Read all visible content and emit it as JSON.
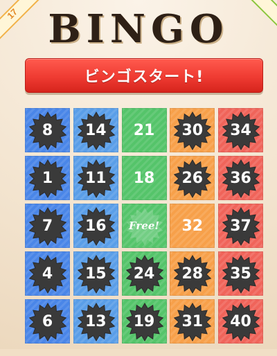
{
  "header": {
    "tagline": "",
    "title": "BINGO",
    "corner_left_text": "17"
  },
  "start_button": {
    "label": "ビンゴスタート!"
  },
  "board": {
    "colors": {
      "blue": "#4a86e8",
      "lblue": "#5a9ee8",
      "green": "#55c46a",
      "orange": "#f7a04a",
      "red": "#f0645a",
      "burst": "#3a3a3a"
    },
    "free_label": "Free!",
    "rows": [
      [
        {
          "value": "8",
          "color": "blue",
          "marked": true
        },
        {
          "value": "14",
          "color": "lblue",
          "marked": true
        },
        {
          "value": "21",
          "color": "green",
          "marked": false
        },
        {
          "value": "30",
          "color": "orange",
          "marked": true
        },
        {
          "value": "34",
          "color": "red",
          "marked": true
        }
      ],
      [
        {
          "value": "1",
          "color": "blue",
          "marked": true
        },
        {
          "value": "11",
          "color": "lblue",
          "marked": true
        },
        {
          "value": "18",
          "color": "green",
          "marked": false
        },
        {
          "value": "26",
          "color": "orange",
          "marked": true
        },
        {
          "value": "36",
          "color": "red",
          "marked": true
        }
      ],
      [
        {
          "value": "7",
          "color": "blue",
          "marked": true
        },
        {
          "value": "16",
          "color": "lblue",
          "marked": true
        },
        {
          "value": "Free!",
          "color": "green",
          "marked": false,
          "free": true
        },
        {
          "value": "32",
          "color": "orange",
          "marked": false
        },
        {
          "value": "37",
          "color": "red",
          "marked": true
        }
      ],
      [
        {
          "value": "4",
          "color": "blue",
          "marked": true
        },
        {
          "value": "15",
          "color": "lblue",
          "marked": true
        },
        {
          "value": "24",
          "color": "green",
          "marked": true
        },
        {
          "value": "28",
          "color": "orange",
          "marked": true
        },
        {
          "value": "35",
          "color": "red",
          "marked": true
        }
      ],
      [
        {
          "value": "6",
          "color": "blue",
          "marked": true
        },
        {
          "value": "13",
          "color": "lblue",
          "marked": true
        },
        {
          "value": "19",
          "color": "green",
          "marked": true
        },
        {
          "value": "31",
          "color": "orange",
          "marked": true
        },
        {
          "value": "40",
          "color": "red",
          "marked": true
        }
      ]
    ]
  }
}
